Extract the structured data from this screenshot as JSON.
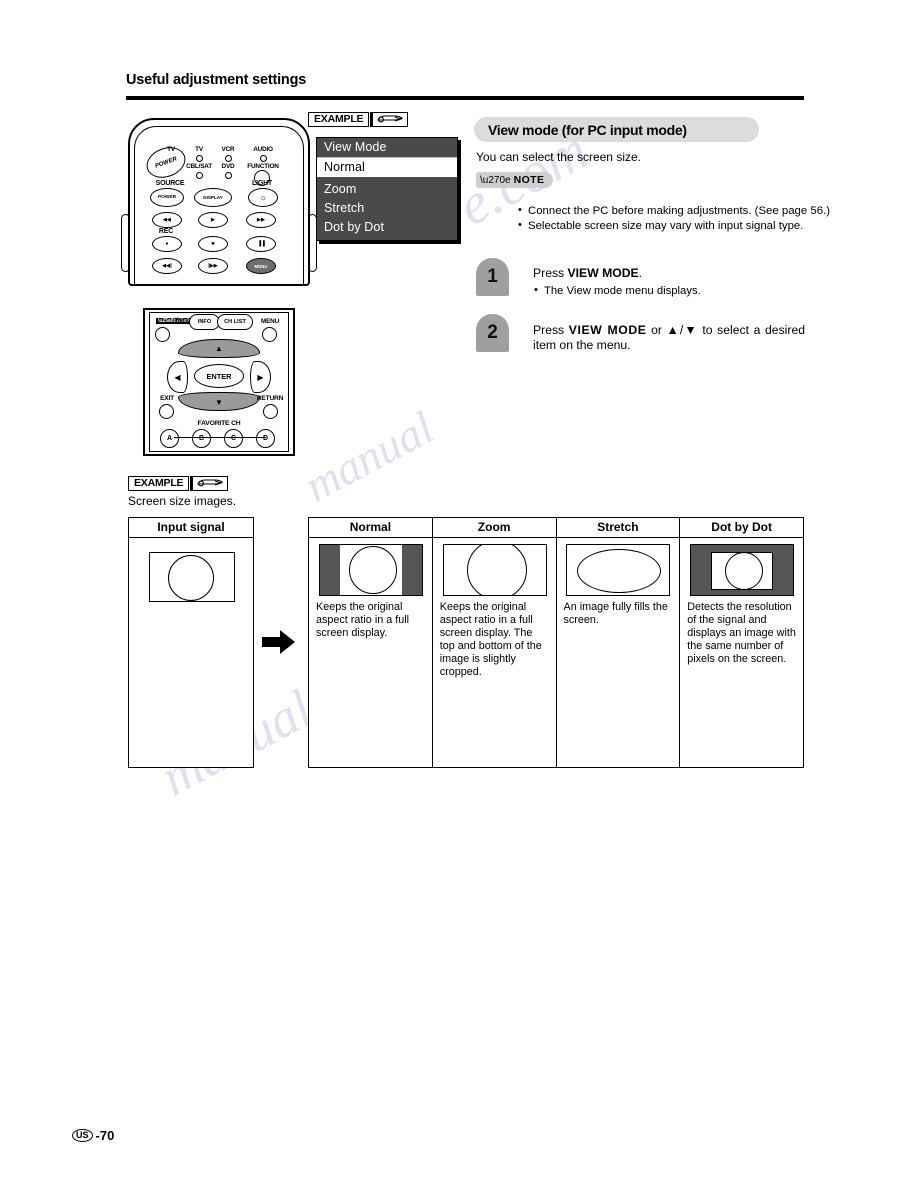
{
  "header": {
    "title": "Useful adjustment settings"
  },
  "watermark": {
    "line1": "ve.com",
    "line2": "manualzilla",
    "line3": "manual"
  },
  "remote_top": {
    "labels": {
      "tv_power": "TV",
      "tv": "TV",
      "vcr": "VCR",
      "audio": "AUDIO",
      "cblsat": "CBL/SAT",
      "dvd": "DVD",
      "function": "FUNCTION",
      "source": "SOURCE",
      "light": "LIGHT",
      "rec": "REC"
    },
    "buttons": {
      "power_big": "POWER",
      "power": "POWER",
      "display": "DISPLAY",
      "light": "☼",
      "rew": "◀◀",
      "play": "▶",
      "ff": "▶▶",
      "rec": "●",
      "stop": "■",
      "pause": "▐▐",
      "prev": "◀◀|",
      "next": "|▶▶",
      "menu_dark": "MENU"
    }
  },
  "remote_bottom": {
    "labels": {
      "virtual": "Virtual",
      "info": "INFO",
      "ch_list": "CH LIST",
      "menu": "MENU",
      "exit": "EXIT",
      "return": "RETURN",
      "favorite": "FAVORITE CH",
      "enter": "ENTER"
    },
    "favorite_buttons": [
      "A",
      "B",
      "C",
      "D"
    ],
    "dpad": {
      "up": "▲",
      "down": "▼",
      "left": "◀",
      "right": "▶"
    }
  },
  "example_tag": {
    "label": "EXAMPLE",
    "icon": "pointing-hand-icon"
  },
  "osd_menu": {
    "title": "View Mode",
    "items": [
      {
        "label": "Normal",
        "selected": true
      },
      {
        "label": "Zoom",
        "selected": false
      },
      {
        "label": "Stretch",
        "selected": false
      },
      {
        "label": "Dot by Dot",
        "selected": false
      }
    ]
  },
  "section": {
    "banner_title": "View mode (for PC input mode)",
    "lead": "You can select the screen size.",
    "note_label": "NOTE",
    "notes": [
      "Connect the PC before making adjustments. (See page 56.)",
      "Selectable screen size may vary with input signal type."
    ]
  },
  "steps": [
    {
      "number": "1",
      "text_before": "Press ",
      "bold": "VIEW MODE",
      "text_after": ".",
      "substep": "The View mode menu displays."
    },
    {
      "number": "2",
      "text_before": "Press ",
      "bold": "VIEW MODE",
      "text_after": " or ▲/▼ to select a desired item on the menu.",
      "substep": ""
    }
  ],
  "screen_size_section": {
    "caption": "Screen size images.",
    "input_column_header": "Input signal",
    "arrow": "right-arrow-icon",
    "columns": [
      {
        "header": "Normal",
        "description": "Keeps the original aspect ratio in a full screen display.",
        "thumb": "pillarbox"
      },
      {
        "header": "Zoom",
        "description": "Keeps the original aspect ratio in a full screen display. The top and bottom of the image is slightly cropped.",
        "thumb": "full-cropped"
      },
      {
        "header": "Stretch",
        "description": "An image fully fills the screen.",
        "thumb": "stretched"
      },
      {
        "header": "Dot by Dot",
        "description": "Detects the resolution of the signal and displays an image with the same number of pixels on the screen.",
        "thumb": "windowbox"
      }
    ]
  },
  "footer": {
    "region": "US",
    "page": "-70"
  }
}
